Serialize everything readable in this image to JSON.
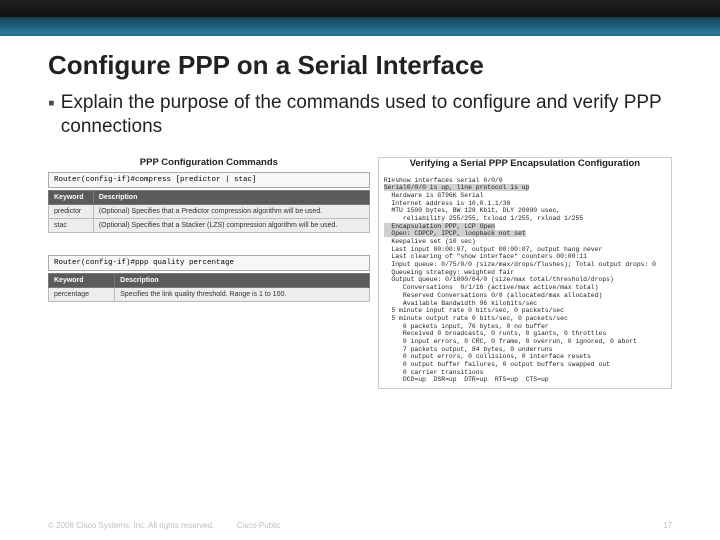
{
  "slide": {
    "title": "Configure PPP on a Serial Interface",
    "bullet": "Explain the purpose of the commands used to configure and verify PPP connections"
  },
  "left_panel": {
    "title": "PPP Configuration Commands",
    "cmd1": "Router(config-if)#compress [predictor | stac]",
    "table1": {
      "h1": "Keyword",
      "h2": "Description",
      "r1c1": "predictor",
      "r1c2": "(Optional) Specifies that a Predictor compression algorithm will be used.",
      "r2c1": "stac",
      "r2c2": "(Optional) Specifies that a Stacker (LZS) compression algorithm will be used."
    },
    "cmd2": "Router(config-if)#ppp quality percentage",
    "table2": {
      "h1": "Keyword",
      "h2": "Description",
      "r1c1": "percentage",
      "r1c2": "Specifies the link quality threshold. Range is 1 to 100."
    }
  },
  "right_panel": {
    "title": "Verifying a Serial PPP Encapsulation Configuration",
    "cli": "R1#show interfaces serial 0/0/0\nSerial0/0/0 is up, line protocol is up\n  Hardware is GT96K Serial\n  Internet address is 10.0.1.1/30\n  MTU 1500 bytes, BW 128 Kbit, DLY 20000 usec,\n     reliability 255/255, txload 1/255, rxload 1/255\n  Encapsulation PPP, LCP Open\n  Open: CDPCP, IPCP, loopback not set\n  Keepalive set (10 sec)\n  Last input 00:00:07, output 00:00:07, output hang never\n  Last clearing of \"show interface\" counters 00:00:11\n  Input queue: 0/75/0/0 (size/max/drops/flushes); Total output drops: 0\n  Queueing strategy: weighted fair\n  Output queue: 0/1000/64/0 (size/max total/threshold/drops)\n     Conversations  0/1/16 (active/max active/max total)\n     Reserved Conversations 0/0 (allocated/max allocated)\n     Available Bandwidth 96 kilobits/sec\n  5 minute input rate 0 bits/sec, 0 packets/sec\n  5 minute output rate 0 bits/sec, 0 packets/sec\n     6 packets input, 76 bytes, 0 no buffer\n     Received 0 broadcasts, 0 runts, 0 giants, 0 throttles\n     0 input errors, 0 CRC, 0 frame, 0 overrun, 0 ignored, 0 abort\n     7 packets output, 84 bytes, 0 underruns\n     0 output errors, 0 collisions, 0 interface resets\n     0 output buffer failures, 0 output buffers swapped out\n     0 carrier transitions\n     DCD=up  DSR=up  DTR=up  RTS=up  CTS=up"
  },
  "footer": {
    "copyright": "© 2006 Cisco Systems, Inc. All rights reserved.",
    "public": "Cisco Public",
    "page": "17"
  }
}
